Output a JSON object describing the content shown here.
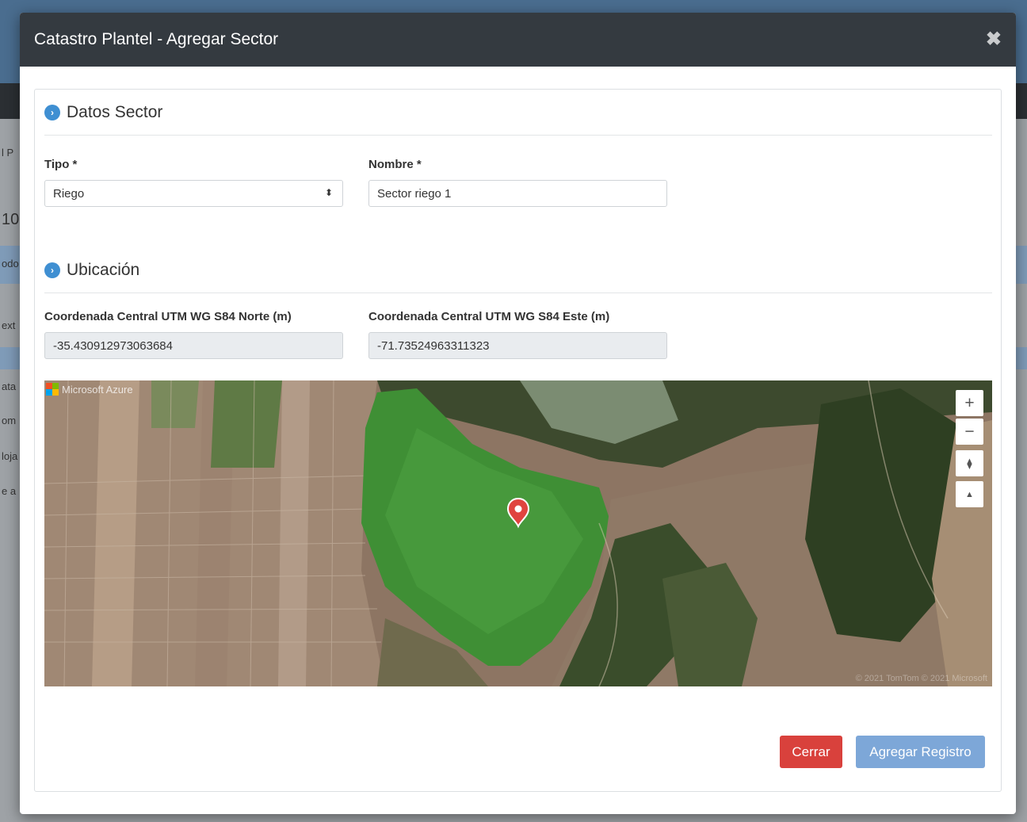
{
  "backdrop": {
    "fragments": [
      "l P",
      "10",
      "odo",
      "ext",
      "ata",
      "om",
      "loja",
      "e a"
    ]
  },
  "modal": {
    "title": "Catastro Plantel - Agregar Sector",
    "close_glyph": "✖"
  },
  "datos_sector": {
    "title": "Datos Sector",
    "tipo_label": "Tipo *",
    "tipo_value": "Riego",
    "nombre_label": "Nombre *",
    "nombre_value": "Sector riego 1"
  },
  "ubicacion": {
    "title": "Ubicación",
    "norte_label": "Coordenada Central UTM WG S84 Norte (m)",
    "norte_value": "-35.430912973063684",
    "este_label": "Coordenada Central UTM WG S84 Este (m)",
    "este_value": "-71.73524963311323"
  },
  "map": {
    "brand": "Microsoft Azure",
    "zoom_in": "+",
    "zoom_out": "−",
    "compass": "⧫",
    "pitch": "▲",
    "copyright": "© 2021 TomTom © 2021 Microsoft",
    "marker_icon": "map-pin-icon",
    "colors": {
      "field_green": "#3f8f35",
      "farmland": "#a08874",
      "forest": "#2e3f22"
    }
  },
  "footer": {
    "close_label": "Cerrar",
    "submit_label": "Agregar Registro"
  }
}
